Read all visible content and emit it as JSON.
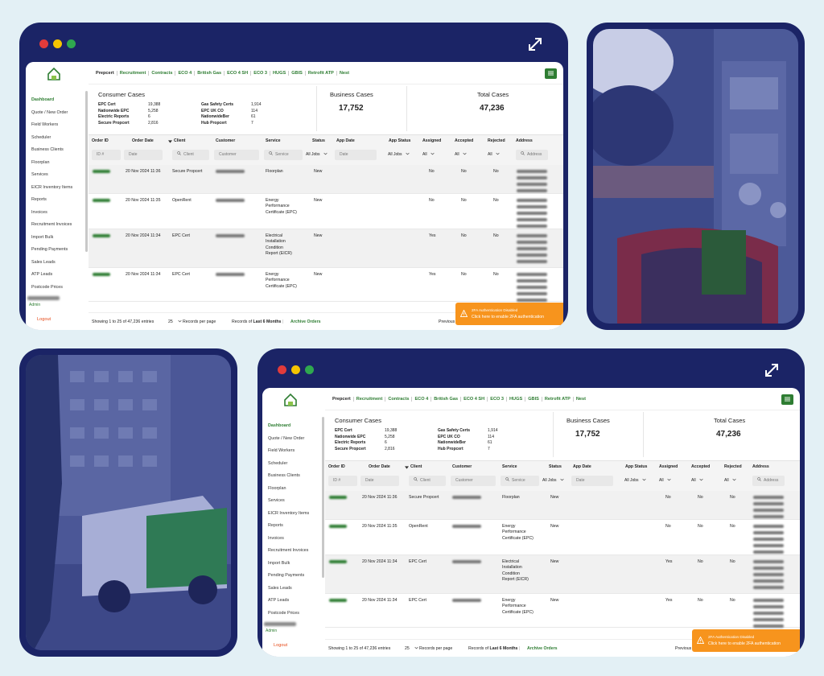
{
  "nav_tabs": [
    "Prepcert",
    "Recruitment",
    "Contracts",
    "ECO 4",
    "British Gas",
    "ECO 4 SH",
    "ECO 3",
    "HUGS",
    "GBIS",
    "Retrofit ATP",
    "Nest"
  ],
  "sidebar_items": [
    "Dashboard",
    "Quote / New Order",
    "Field Workers",
    "Scheduler",
    "Business Clients",
    "Floorplan",
    "Services",
    "EICR Inventory Items",
    "Reports",
    "Invoices",
    "Recruitment Invoices",
    "Import Bulk",
    "Pending Payments",
    "Sales Leads",
    "ATP Leads",
    "Postcode Prices"
  ],
  "sidebar_admin": "Admin",
  "sidebar_logout": "Logout",
  "consumer": {
    "title": "Consumer Cases",
    "left": [
      [
        "EPC Cert",
        "19,388"
      ],
      [
        "Nationwide EPC",
        "5,258"
      ],
      [
        "Electric Reports",
        "6"
      ],
      [
        "Secure Propcert",
        "2,816"
      ]
    ],
    "right": [
      [
        "Gas Safety Certs",
        "1,914"
      ],
      [
        "EPC UK CO",
        "114"
      ],
      [
        "NationwideBer",
        "61"
      ],
      [
        "Hub Propcert",
        "7"
      ]
    ]
  },
  "business": {
    "title": "Business Cases",
    "value": "17,752"
  },
  "total": {
    "title": "Total Cases",
    "value": "47,236"
  },
  "columns": [
    "Order ID",
    "Order Date",
    "Client",
    "Customer",
    "Service",
    "Status",
    "App Date",
    "App Status",
    "Assigned",
    "Accepted",
    "Rejected",
    "Address"
  ],
  "filters": {
    "order_id": "ID #",
    "date": "Date",
    "client": "Client",
    "customer": "Customer",
    "service": "Service",
    "all_jobs": "All Jobs",
    "all": "All",
    "address": "Address"
  },
  "rows": [
    {
      "date": "20 Nov 2024 11:36",
      "client": "Secure Propcert",
      "service": [
        "Floorplan"
      ],
      "status": "New",
      "assigned": "No",
      "accepted": "No",
      "rejected": "No",
      "addr_lines": 4
    },
    {
      "date": "20 Nov 2024 11:35",
      "client": "OpenRent",
      "service": [
        "Energy",
        "Performance",
        "Certificate (EPC)"
      ],
      "status": "New",
      "assigned": "No",
      "accepted": "No",
      "rejected": "No",
      "addr_lines": 5
    },
    {
      "date": "20 Nov 2024 11:34",
      "client": "EPC Cert",
      "service": [
        "Electrical",
        "Installation",
        "Condition",
        "Report (EICR)"
      ],
      "status": "New",
      "assigned": "Yes",
      "accepted": "No",
      "rejected": "No",
      "addr_lines": 5
    },
    {
      "date": "20 Nov 2024 11:34",
      "client": "EPC Cert",
      "service": [
        "Energy",
        "Performance",
        "Certificate (EPC)"
      ],
      "status": "New",
      "assigned": "Yes",
      "accepted": "No",
      "rejected": "No",
      "addr_lines": 5
    }
  ],
  "footer": {
    "showing": "Showing 1 to 25 of 47,236 entries",
    "per_page_value": "25",
    "per_page_label": "Records per page",
    "records_of": "Records of",
    "last_months": "Last 6 Months",
    "archive": "Archive Orders",
    "previous": "Previous"
  },
  "toast": {
    "line1": "2FA Authentication Disabled",
    "line2": "Click here to enable 2FA authentication"
  },
  "colors": {
    "panel": "#1b2466",
    "background": "#e3f0f5",
    "brand_green": "#2e7d32",
    "toast_orange": "#f7941d",
    "dot_red": "#e23b3b",
    "dot_yellow": "#f5c400",
    "dot_green": "#2fa84f"
  },
  "icons": [
    "expand-icon",
    "search-icon",
    "sort-icon",
    "chevron-down-icon",
    "warning-icon",
    "menu-icon",
    "logo-icon"
  ]
}
